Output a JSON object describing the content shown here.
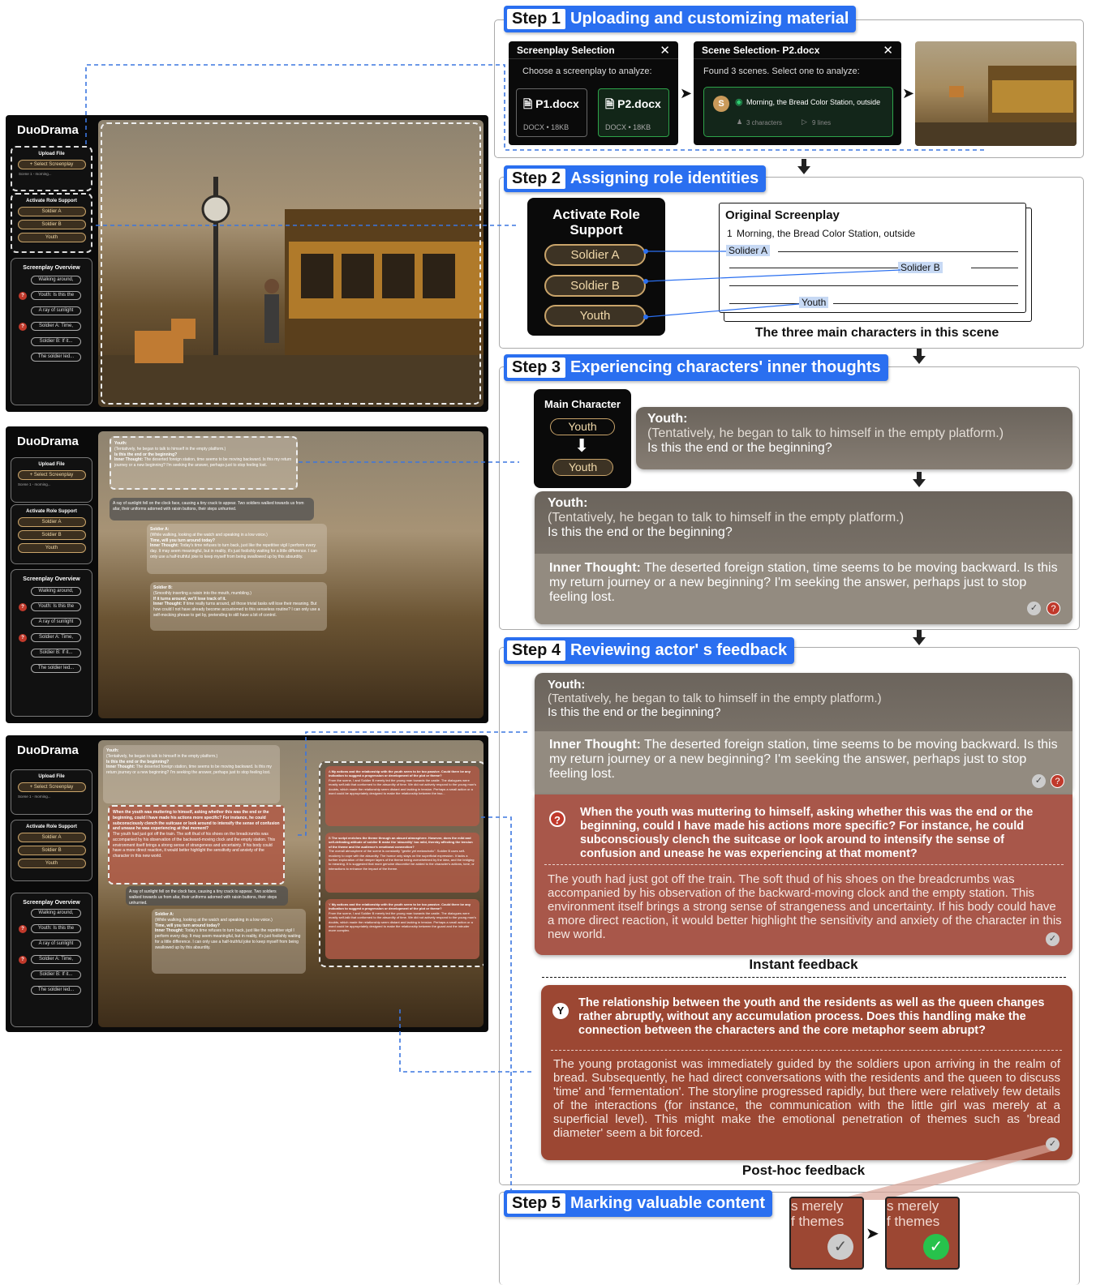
{
  "mockup": {
    "brand": "DuoDrama",
    "upload_header": "Upload File",
    "select_btn": "Select Screenplay",
    "scene_small": "Scene 1 - morning...",
    "role_header": "Activate Role Support",
    "roles": [
      "Soldier A",
      "Soldier B",
      "Youth"
    ],
    "overview_header": "Screenplay Overview",
    "overview_items": [
      {
        "label": "Walking around,",
        "flag": false
      },
      {
        "label": "Youth: Is this the",
        "flag": true
      },
      {
        "label": "A ray of sunlight",
        "flag": false
      },
      {
        "label": "Soldier A: Time,",
        "flag": true
      },
      {
        "label": "Soldier B: If it...",
        "flag": false
      },
      {
        "label": "The soldier led...",
        "flag": false
      }
    ],
    "m2_youth": {
      "name": "Youth:",
      "dir": "(Tentatively, he began to talk to himself in the empty platform.)",
      "line": "Is this the end or the beginning?",
      "thought_label": "Inner Thought:",
      "thought": "The deserted foreign station, time seems to be moving backward. Is this my return journey or a new beginning? I'm seeking the answer, perhaps just to stop feeling lost."
    },
    "m2_action": "A ray of sunlight fell on the clock face, causing a tiny crack to appear. Two soldiers walked towards us from afar, their uniforms adorned with raisin buttons, their steps unhurried.",
    "m2_soldierA": {
      "name": "Soldier A:",
      "dir": "(While walking, looking at the watch and speaking in a low voice.)",
      "line": "Time, will you turn around today?",
      "thought_label": "Inner Thought:",
      "thought": "Today's time refuses to turn back, just like the repetitive vigil I perform every day. It may seem meaningful, but in reality, it's just foolishly waiting for a little difference. I can only use a half-truthful joke to keep myself from being swallowed up by this absurdity."
    },
    "m2_soldierB": {
      "name": "Soldier B:",
      "dir": "(Smoothly inserting a raisin into the mouth, mumbling.)",
      "line": "If it turns around, we'll lose track of it.",
      "thought_label": "Inner Thought:",
      "thought": "If time really turns around, all those trivial tasks will lose their meaning. But how could I not have already become accustomed to this senseless routine? I can only use a self-mocking phrase to get by, pretending to still have a bit of control."
    },
    "m3_q": "When the youth was muttering to himself, asking whether this was the end or the beginning, could I have made his actions more specific? For instance, he could subconsciously clench the suitcase or look around to intensify the sense of confusion and unease he was experiencing at that moment?",
    "m3_qbody": "The youth had just got off the train. The soft thud of his shoes on the breadcrumbs was accompanied by his observation of the backward-moving clock and the empty station. This environment itself brings a strong sense of strangeness and uncertainty. If his body could have a more direct reaction, it would better highlight the sensitivity and anxiety of the character in this new world.",
    "m3_cards": [
      {
        "badge": "A",
        "head": "My actions and the relationship with the youth seem to be too passive. Could there be any indication to suggest a progression or development of the plot or theme?",
        "body": "From the scene, I and Soldier B merely led the young man towards the castle. The dialogues were mostly self-talk that conformed to the absurdity of time. We did not actively respond to the young man's doubts, which made the relationship seem distant and lacking in tension. Perhaps a small action or a word could be appropriately designed to make the relationship between the two..."
      },
      {
        "badge": "B",
        "head": "The script enriches the theme through an absurd atmosphere. However, does the mild and self-defeating attitude of soldier B make the 'absurdity' too mild, thereby affecting the tension of the theme and the audience's emotional connection?",
        "body": "The overall atmosphere of the scene is constantly \"gentle yet melancholic\". Soldier B uses self-mockery to cope with the absurdity. The humor only stays on the superficial expression. It lacks a further exploration of the deeper layers of the theme being overwhelmed by the idea, and the bridging to meaning. It is suggested that more genuine discomfort be added to the character's actions, tone, or interactions to enhance the impact of the theme."
      },
      {
        "badge": "Y",
        "head": "My actions and the relationship with the youth seem to be too passive. Could there be any indication to suggest a progression or development of the plot or theme?",
        "body": "From the scene, I and Soldier B merely led the young man towards the castle. The dialogues were mostly self-talk that conformed to the absurdity of time. We did not actively respond to the young man's doubts, which made the relationship seem distant and lacking in tension. Perhaps a small action or a word could be appropriately designed to make the relationship between the guard and the intruder more complex."
      }
    ]
  },
  "steps": [
    {
      "num": "Step 1",
      "title": "Uploading and customizing material"
    },
    {
      "num": "Step 2",
      "title": "Assigning role identities"
    },
    {
      "num": "Step 3",
      "title": "Experiencing characters' inner thoughts"
    },
    {
      "num": "Step 4",
      "title": "Reviewing actor' s feedback"
    },
    {
      "num": "Step 5",
      "title": "Marking valuable content"
    }
  ],
  "step1": {
    "panel1_title": "Screenplay Selection",
    "panel1_prompt": "Choose a screenplay to analyze:",
    "files": [
      {
        "name": "P1.docx",
        "meta": "DOCX • 18KB"
      },
      {
        "name": "P2.docx",
        "meta": "DOCX • 18KB"
      }
    ],
    "panel2_title": "Scene Selection- P2.docx",
    "panel2_prompt": "Found 3 scenes. Select one to analyze:",
    "scene_badge": "S",
    "scene_name": "Morning, the Bread Color Station, outside",
    "scene_chars": "3 characters",
    "scene_lines": "9 lines",
    "close": "✕"
  },
  "step2": {
    "panel_title": "Activate Role Support",
    "roles": [
      "Soldier A",
      "Soldier B",
      "Youth"
    ],
    "orig_title": "Original Screenplay",
    "orig_num": "1",
    "orig_scene": "Morning, the Bread Color Station, outside",
    "hl": [
      "Solider A",
      "Solider B",
      "Youth"
    ],
    "caption": "The three main characters in this scene"
  },
  "step3": {
    "main_title": "Main Character",
    "from": "Youth",
    "to": "Youth",
    "speaker": "Youth:",
    "direction": "(Tentatively, he began to talk to himself in the empty platform.)",
    "line": "Is this the end or the beginning?",
    "thought_label": "Inner Thought:",
    "thought": "The deserted foreign station, time seems to be moving backward. Is this my return journey or a new beginning? I'm seeking the answer, perhaps just to stop feeling lost."
  },
  "step4": {
    "speaker": "Youth:",
    "direction": "(Tentatively, he began to talk to himself in the empty platform.)",
    "line": "Is this the end or the beginning?",
    "thought_label": "Inner Thought:",
    "thought": "The deserted foreign station, time seems to be moving backward. Is this my return journey or a new beginning? I'm seeking the answer, perhaps just to stop feeling lost.",
    "instant_badge": "?",
    "instant_q": "When the youth was muttering to himself, asking whether this was the end or the beginning, could I have made his actions more specific? For instance, he could subconsciously clench the suitcase or look around to intensify the sense of confusion and unease he was experiencing at that moment?",
    "instant_body": "The youth had just got off the train. The soft thud of his shoes on the breadcrumbs was accompanied by his observation of the backward-moving clock and the empty station. This environment itself brings a strong sense of strangeness and uncertainty. If his body could have a more direct reaction, it would better highlight the sensitivity and anxiety of the character in this new world.",
    "instant_caption": "Instant feedback",
    "posthoc_badge": "Y",
    "posthoc_q": "The relationship between the youth and the residents as well as the queen changes rather abruptly, without any accumulation process. Does this handling make the connection between the characters and the core metaphor seem abrupt?",
    "posthoc_body": "The young protagonist was immediately guided by the soldiers upon arriving in the realm of bread. Subsequently, he had direct conversations with the residents and the queen to discuss 'time' and 'fermentation'. The storyline progressed rapidly, but there were relatively few details of the interactions (for instance, the communication with the little girl was merely at a superficial level). This might make the emotional penetration of themes such as 'bread diameter' seem a bit forced.",
    "posthoc_caption": "Post-hoc feedback"
  },
  "step5": {
    "snippet_line1": "s merely",
    "snippet_line2": "f themes"
  },
  "colors": {
    "step_blue": "#2a6ff0",
    "dash_blue": "#3b76e0",
    "feedback_red": "#9c4733",
    "check_green": "#27c24c"
  }
}
